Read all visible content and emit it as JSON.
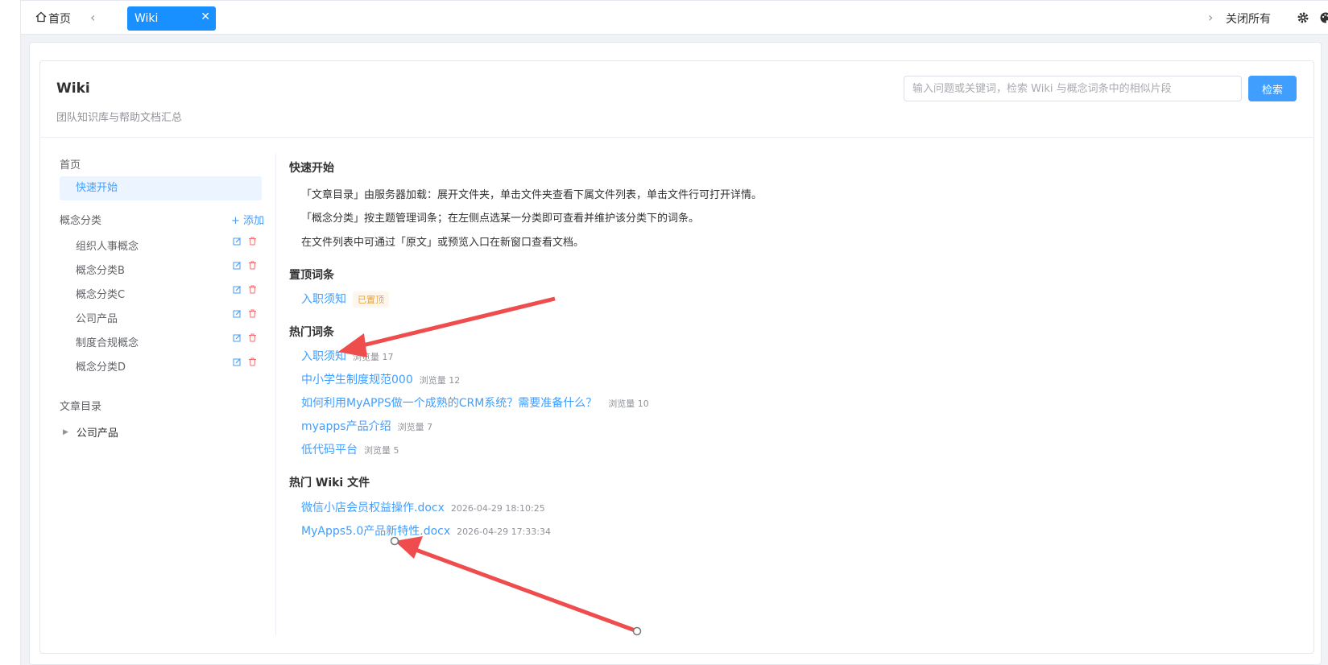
{
  "topbar": {
    "home_label": "首页",
    "active_tab": "Wiki",
    "close_all_label": "关闭所有"
  },
  "header": {
    "title": "Wiki",
    "subtitle": "团队知识库与帮助文档汇总",
    "search_placeholder": "输入问题或关键词，检索 Wiki 与概念词条中的相似片段",
    "search_button": "检索"
  },
  "sidebar": {
    "home_label": "首页",
    "quick_start": "快速开始",
    "categories_label": "概念分类",
    "add_label": "添加",
    "categories": [
      "组织人事概念",
      "概念分类B",
      "概念分类C",
      "公司产品",
      "制度合规概念",
      "概念分类D"
    ],
    "articles_label": "文章目录",
    "articles": [
      "公司产品"
    ]
  },
  "main": {
    "quick_start_title": "快速开始",
    "tips": [
      "「文章目录」由服务器加载：展开文件夹，单击文件夹查看下属文件列表，单击文件行可打开详情。",
      "「概念分类」按主题管理词条；在左侧点选某一分类即可查看并维护该分类下的词条。",
      "在文件列表中可通过「原文」或预览入口在新窗口查看文档。"
    ],
    "pinned_title": "置顶词条",
    "pinned": [
      {
        "title": "入职须知",
        "tag": "已置顶"
      }
    ],
    "hot_title": "热门词条",
    "hot": [
      {
        "title": "入职须知",
        "views": "浏览量 17"
      },
      {
        "title": "中小学生制度规范000",
        "views": "浏览量 12"
      },
      {
        "title": "如何利用MyAPPS做一个成熟的CRM系统？需要准备什么？",
        "views": "浏览量 10"
      },
      {
        "title": "myapps产品介绍",
        "views": "浏览量 7"
      },
      {
        "title": "低代码平台",
        "views": "浏览量 5"
      }
    ],
    "files_title": "热门 Wiki 文件",
    "files": [
      {
        "title": "微信小店会员权益操作.docx",
        "time": "2026-04-29 18:10:25"
      },
      {
        "title": "MyApps5.0产品新特性.docx",
        "time": "2026-04-29 17:33:34"
      }
    ]
  },
  "colors": {
    "primary": "#409eff",
    "tab_active": "#1890ff",
    "annotation_arrow": "#ef4d4d",
    "pinned_tag": "#e6a23c"
  }
}
